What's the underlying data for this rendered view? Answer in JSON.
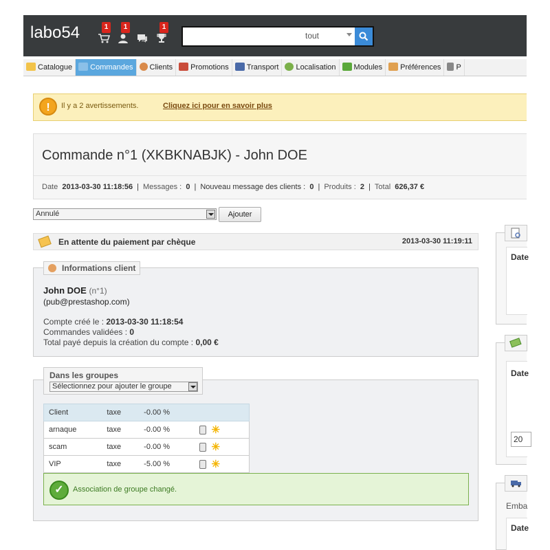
{
  "header": {
    "shop_name": "labo54",
    "notifications": [
      {
        "name": "orders",
        "count": "1",
        "icon": "cart-icon"
      },
      {
        "name": "customers",
        "count": "1",
        "icon": "user-icon"
      },
      {
        "name": "messages",
        "count": "",
        "icon": "chat-icon"
      },
      {
        "name": "trophy",
        "count": "1",
        "icon": "trophy-icon"
      }
    ],
    "search": {
      "value": "",
      "scope": "tout"
    }
  },
  "menu": [
    {
      "label": "Catalogue",
      "icon": "folder-icon",
      "color": "#f2c34a",
      "active": false
    },
    {
      "label": "Commandes",
      "icon": "cart-icon",
      "color": "#8bc0e8",
      "active": true
    },
    {
      "label": "Clients",
      "icon": "user-icon",
      "color": "#d98a4a",
      "active": false
    },
    {
      "label": "Promotions",
      "icon": "calendar-icon",
      "color": "#c94c3a",
      "active": false
    },
    {
      "label": "Transport",
      "icon": "truck-icon",
      "color": "#4a6aa8",
      "active": false
    },
    {
      "label": "Localisation",
      "icon": "globe-icon",
      "color": "#7bb04a",
      "active": false
    },
    {
      "label": "Modules",
      "icon": "puzzle-icon",
      "color": "#5aa83a",
      "active": false
    },
    {
      "label": "Préférences",
      "icon": "prefs-icon",
      "color": "#e0a050",
      "active": false
    },
    {
      "label": "P",
      "icon": "wrench-icon",
      "color": "#888888",
      "active": false
    }
  ],
  "warning": {
    "text": "Il y a 2 avertissements.",
    "link": "Cliquez ici pour en savoir plus"
  },
  "order": {
    "title": "Commande n°1 (XKBKNABJK) - John DOE",
    "date_label": "Date",
    "date_value": "2013-03-30 11:18:56",
    "messages_label": "Messages :",
    "messages_value": "0",
    "new_messages_label": "Nouveau message des clients :",
    "new_messages_value": "0",
    "products_label": "Produits :",
    "products_value": "2",
    "total_label": "Total",
    "total_value": "626,37 €"
  },
  "status_form": {
    "selected": "Annulé",
    "add_button": "Ajouter"
  },
  "payment_status": {
    "label": "En attente du paiement par chèque",
    "date": "2013-03-30 11:19:11"
  },
  "client": {
    "legend": "Informations client",
    "name": "John DOE",
    "id": "(n°1)",
    "email": "(pub@prestashop.com)",
    "created_label": "Compte créé le : ",
    "created_value": "2013-03-30 11:18:54",
    "orders_label": "Commandes validées : ",
    "orders_value": "0",
    "paid_label": "Total payé depuis la création du compte : ",
    "paid_value": "0,00 €"
  },
  "groups": {
    "legend": "Dans les groupes",
    "select_placeholder": "Sélectionnez pour ajouter le groupe",
    "rows": [
      {
        "name": "Client",
        "tax": "taxe",
        "reduction": "-0.00 %",
        "actions": false
      },
      {
        "name": "arnaque",
        "tax": "taxe",
        "reduction": "-0.00 %",
        "actions": true
      },
      {
        "name": "scam",
        "tax": "taxe",
        "reduction": "-0.00 %",
        "actions": true
      },
      {
        "name": "VIP",
        "tax": "taxe",
        "reduction": "-5.00 %",
        "actions": true
      }
    ],
    "success": "Association de groupe changé."
  },
  "right": {
    "panel1_label": "Date",
    "panel2_label": "Date",
    "panel2_input": "20",
    "panel3_label": "Emba",
    "panel3_label2": "Date"
  }
}
